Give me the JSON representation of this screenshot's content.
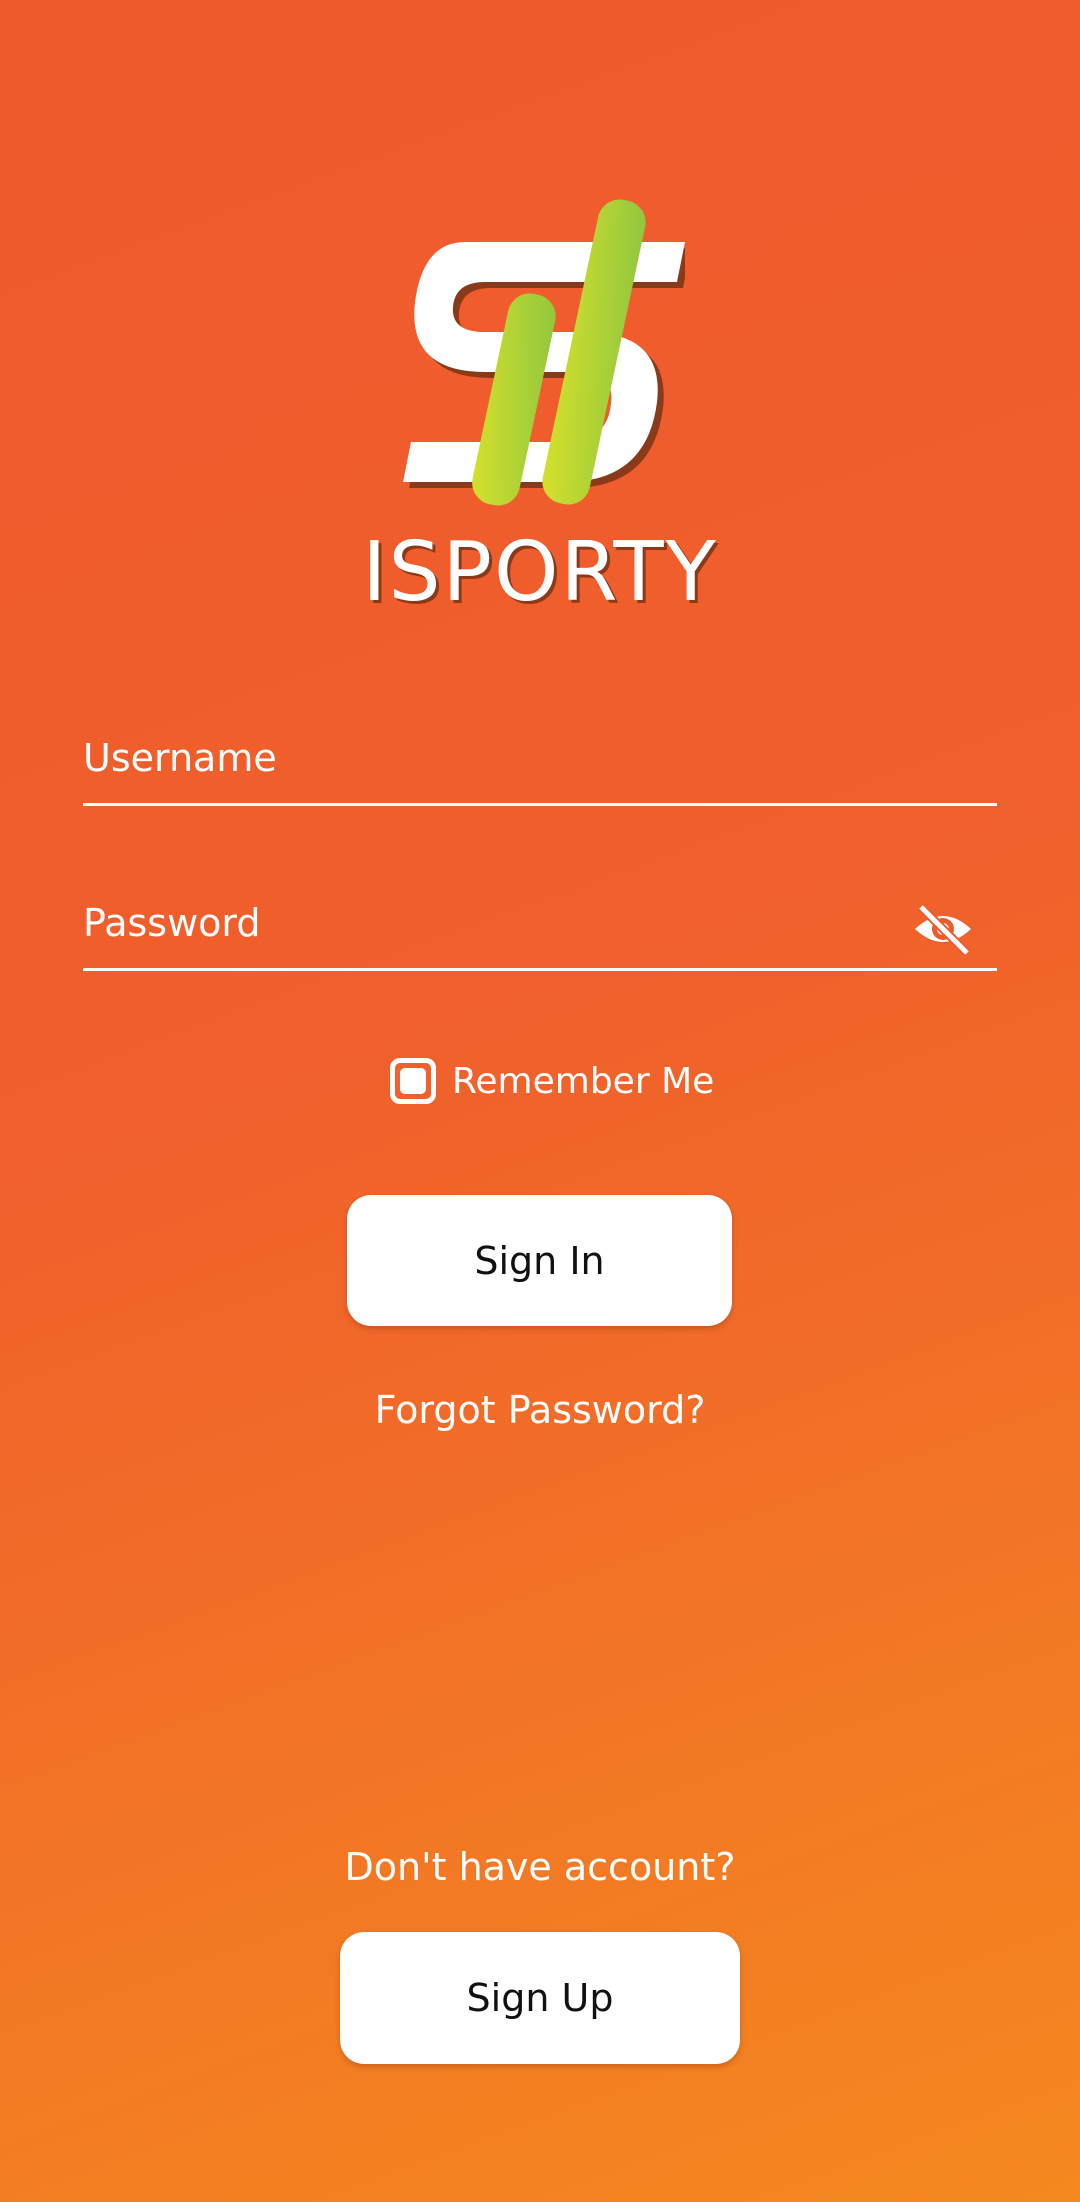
{
  "app": {
    "brand_name": "ISPORTY",
    "accent_color": "#f05a2d",
    "logo_green": "#a8d13a",
    "logo_yellow": "#d7e12b"
  },
  "login": {
    "username_placeholder": "Username",
    "password_placeholder": "Password",
    "password_toggle_icon": "eye-off-icon",
    "remember_me_label": "Remember Me",
    "remember_me_checked": true,
    "sign_in_label": "Sign In",
    "forgot_password_label": "Forgot Password?"
  },
  "signup": {
    "prompt": "Don't have account?",
    "button_label": "Sign Up"
  }
}
